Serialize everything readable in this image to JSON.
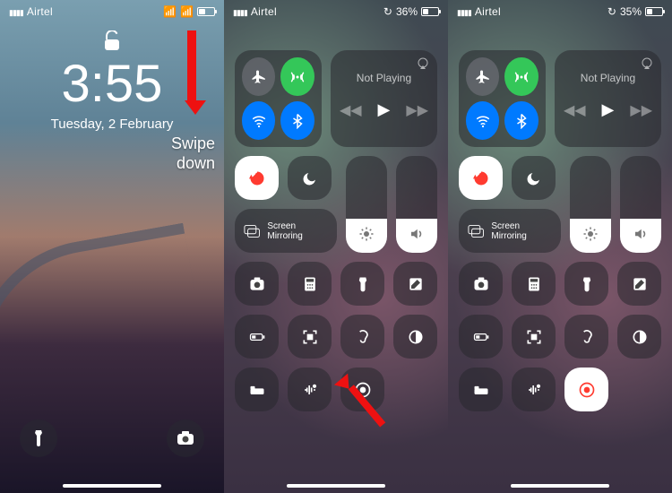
{
  "screens": {
    "lock": {
      "carrier": "Airtel",
      "time": "3:55",
      "date": "Tuesday, 2 February",
      "annotation": "Swipe\ndown"
    },
    "cc1": {
      "carrier": "Airtel",
      "battery_pct": "36%",
      "battery_fill": 36,
      "media_title": "Not Playing",
      "orientation_locked": true,
      "dnd_on": false,
      "mirror_label": "Screen Mirroring",
      "brightness_fill": 35,
      "volume_fill": 35,
      "record_active": false
    },
    "cc2": {
      "carrier": "Airtel",
      "battery_pct": "35%",
      "battery_fill": 35,
      "media_title": "Not Playing",
      "orientation_locked": true,
      "dnd_on": false,
      "mirror_label": "Screen Mirroring",
      "brightness_fill": 35,
      "volume_fill": 35,
      "record_active": true
    },
    "connectivity": {
      "airplane": false,
      "cellular": true,
      "wifi": true,
      "bluetooth": true
    },
    "shortcut_icons": [
      "camera",
      "calculator",
      "flashlight",
      "notes",
      "low-power",
      "qr-scan",
      "hearing",
      "dark-mode",
      "sleep",
      "sound-recognition",
      "screen-record"
    ]
  }
}
